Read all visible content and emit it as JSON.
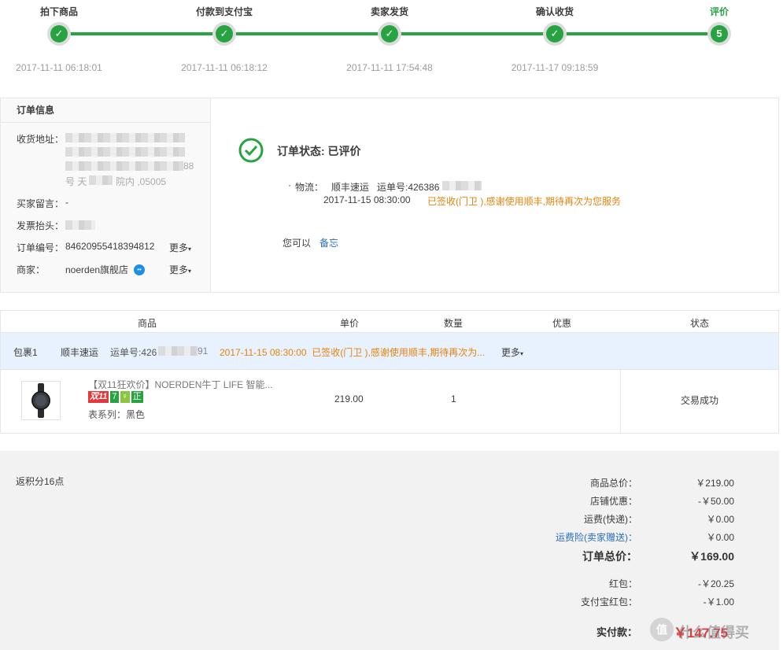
{
  "progress": {
    "steps": [
      {
        "label": "拍下商品",
        "time": "2017-11-11 06:18:01",
        "icon": "check-icon"
      },
      {
        "label": "付款到支付宝",
        "time": "2017-11-11 06:18:12",
        "icon": "check-icon"
      },
      {
        "label": "卖家发货",
        "time": "2017-11-11 17:54:48",
        "icon": "check-icon"
      },
      {
        "label": "确认收货",
        "time": "2017-11-17 09:18:59",
        "icon": "check-icon"
      },
      {
        "label": "评价",
        "time": "",
        "number": "5"
      }
    ],
    "accent_color": "#27a342"
  },
  "order_info": {
    "title": "订单信息",
    "address_label": "收货地址：",
    "address_tail_1": "88",
    "address_tail_2": "号 天",
    "address_tail_3": "院内 ,05005",
    "message_label": "买家留言：",
    "message_value": "-",
    "invoice_label": "发票抬头：",
    "order_no_label": "订单编号：",
    "order_no": "84620955418394812",
    "order_more": "更多",
    "seller_label": "商家：",
    "seller_name": "noerden旗舰店",
    "seller_more": "更多"
  },
  "status": {
    "title": "订单状态: 已评价",
    "logistics_label": "物流：",
    "carrier": "顺丰速运",
    "tracking_label": "运单号:426386",
    "date": "2017-11-15 08:30:00",
    "message": "已签收(门卫 ),感谢使用顺丰,期待再次为您服务",
    "can_label": "您可以",
    "memo_link": "备忘"
  },
  "table": {
    "headers": [
      "商品",
      "单价",
      "数量",
      "优惠",
      "状态"
    ],
    "package": {
      "label": "包裹1",
      "carrier": "顺丰速运",
      "tracking": "运单号:426",
      "tracking_tail": "91",
      "message": "2017-11-15 08:30:00  已签收(门卫 ),感谢使用顺丰,期待再次为...",
      "more": "更多"
    },
    "item": {
      "title": "【双11狂欢价】NOERDEN牛丁 LIFE 智能...",
      "badges": [
        "双11",
        "7",
        "♀",
        "正"
      ],
      "variant": "表系列：黑色",
      "price": "219.00",
      "quantity": "1",
      "status": "交易成功"
    }
  },
  "summary": {
    "points": "返积分16点",
    "rows": [
      {
        "label": "商品总价：",
        "value": "￥219.00"
      },
      {
        "label": "店铺优惠：",
        "value": "-￥50.00"
      },
      {
        "label": "运费(快递)：",
        "value": "￥0.00"
      },
      {
        "label": "运费险(卖家赠送)：",
        "value": "￥0.00"
      }
    ],
    "total_label": "订单总价：",
    "total_value": "￥169.00",
    "hongbao_label": "红包：",
    "hongbao_value": "-￥20.25",
    "alipay_hongbao_label": "支付宝红包：",
    "alipay_hongbao_value": "-￥1.00",
    "paid_label": "实付款：",
    "paid_value": "￥147.75",
    "watermark": "什么值得买"
  }
}
